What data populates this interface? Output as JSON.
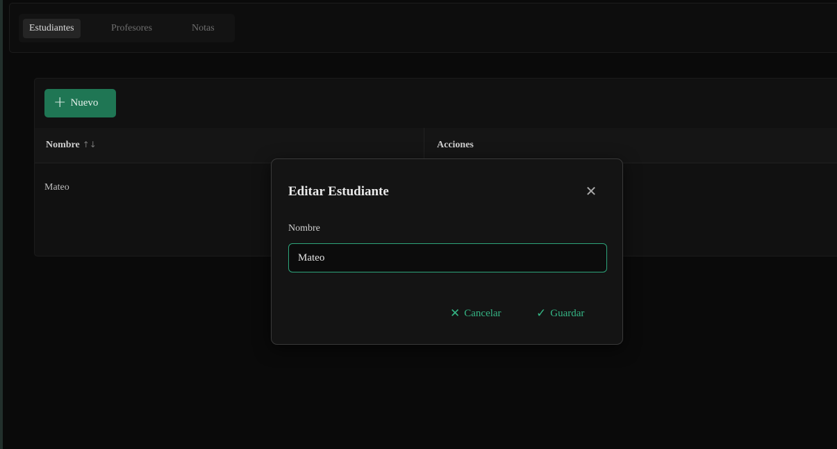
{
  "tabs": [
    {
      "label": "Estudiantes",
      "active": true
    },
    {
      "label": "Profesores",
      "active": false
    },
    {
      "label": "Notas",
      "active": false
    }
  ],
  "toolbar": {
    "new_label": "Nuevo",
    "new_icon": "plus-icon"
  },
  "table": {
    "columns": [
      {
        "label": "Nombre",
        "sortable": true,
        "sort_icon": "sort-icon"
      },
      {
        "label": "Acciones",
        "sortable": false
      }
    ],
    "rows": [
      {
        "nombre": "Mateo"
      }
    ]
  },
  "dialog": {
    "title": "Editar Estudiante",
    "close_icon": "close-icon",
    "field_label": "Nombre",
    "field_value": "Mateo",
    "cancel_label": "Cancelar",
    "cancel_icon": "x-icon",
    "save_label": "Guardar",
    "save_icon": "check-icon"
  },
  "colors": {
    "accent": "#1f7654",
    "accent_text": "#35b685",
    "input_border": "#2ea67c",
    "background": "#0a0a0a"
  }
}
